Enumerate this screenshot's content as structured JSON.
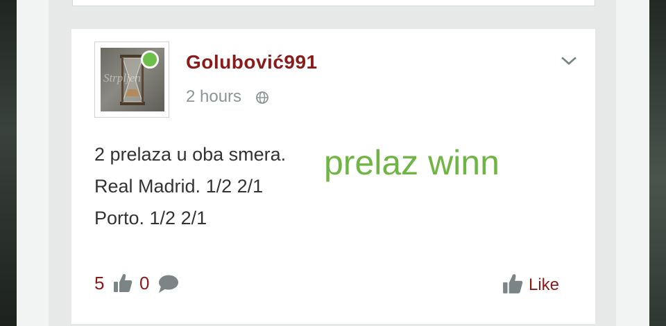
{
  "post": {
    "avatar_watermark": "Strpljen",
    "username": "Golubović991",
    "time_ago": "2 hours",
    "visibility_icon": "globe-icon",
    "lines": [
      "2 prelaza u oba smera.",
      "Real Madrid. 1/2 2/1",
      "Porto. 1/2 2/1"
    ],
    "sticker_text": "prelaz winn",
    "likes_count": "5",
    "comments_count": "0",
    "like_label": "Like"
  },
  "colors": {
    "accent": "#8b1a1a",
    "online": "#6cc04a",
    "sticker": "#6fb543",
    "muted": "#8c9595",
    "icon_gray": "#7b8585"
  }
}
